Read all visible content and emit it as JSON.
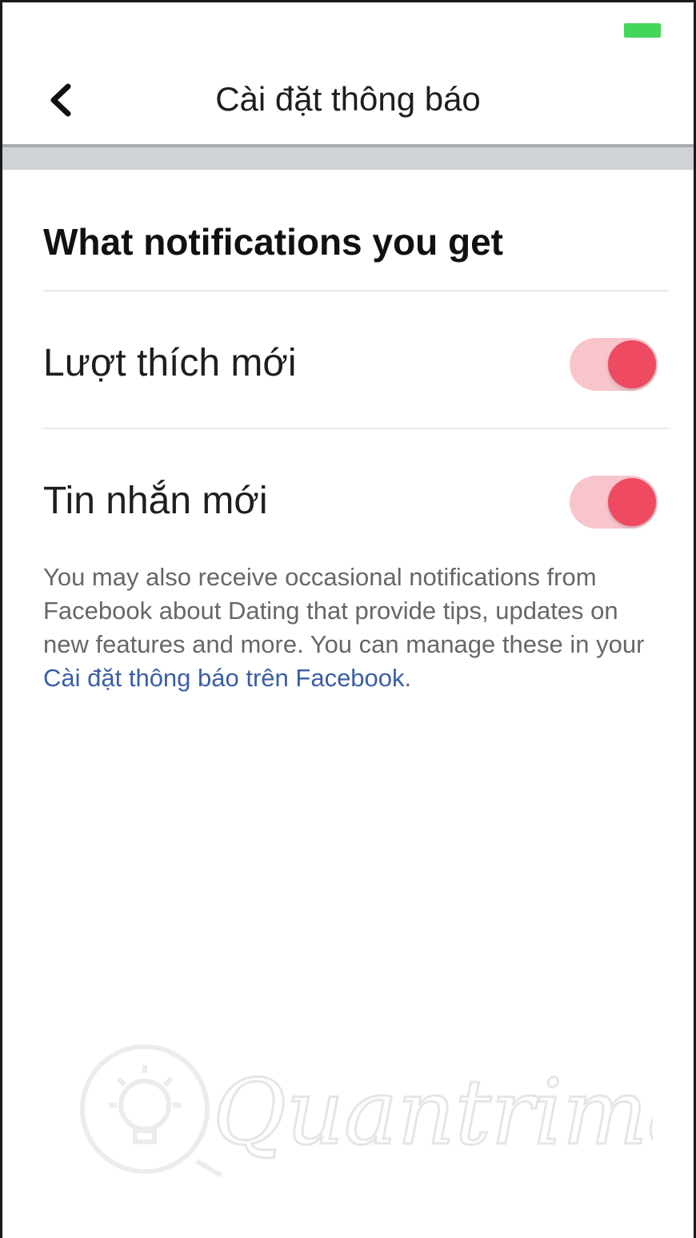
{
  "status_bar": {
    "battery_color": "#44d65a"
  },
  "header": {
    "back_icon": "chevron-left-icon",
    "title": "Cài đặt thông báo"
  },
  "section": {
    "title": "What notifications you get"
  },
  "settings": [
    {
      "label": "Lượt thích mới",
      "enabled": true
    },
    {
      "label": "Tin nhắn mới",
      "enabled": true
    }
  ],
  "info": {
    "text_before_link": "You may also receive occasional notifications from Facebook about Dating that provide tips, updates on new features and more. You can manage these in your ",
    "link_text": "Cài đặt thông báo trên Facebook",
    "text_after_link": "."
  },
  "watermark": {
    "text": "Quantrimang"
  },
  "colors": {
    "toggle_track": "#f8c5cc",
    "toggle_knob": "#ee4a61",
    "link": "#3b5ea6",
    "header_band": "#cfd2d6"
  }
}
